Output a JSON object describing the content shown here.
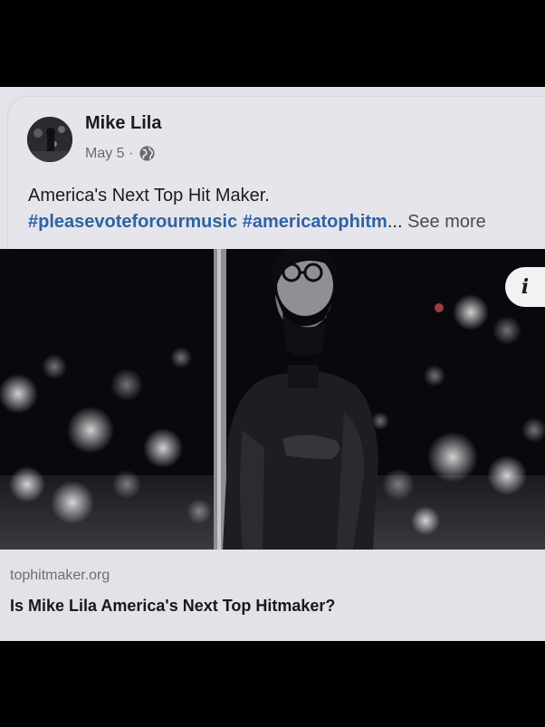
{
  "post": {
    "author": "Mike Lila",
    "date": "May 5",
    "separator": "·",
    "audience_icon": "globe-icon",
    "text": "America's Next Top Hit Maker.",
    "hashtags": [
      "#pleasevoteforourmusic",
      "#americatophitm"
    ],
    "ellipsis": "...",
    "see_more": "See more"
  },
  "media": {
    "info_label": "i",
    "info_icon": "info-icon"
  },
  "link_preview": {
    "domain": "tophitmaker.org",
    "headline": "Is Mike Lila America's Next Top Hitmaker?"
  },
  "colors": {
    "hashtag": "#2d63a4",
    "card_bg": "#e4e3ea",
    "outer_bg": "#000000"
  }
}
